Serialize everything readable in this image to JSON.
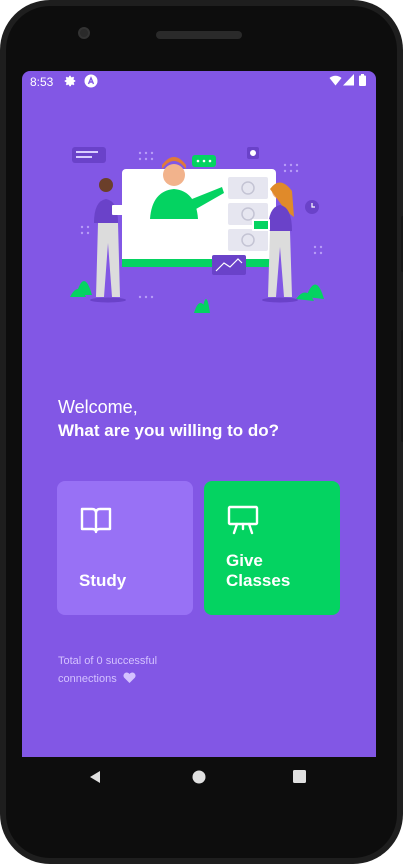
{
  "status_bar": {
    "time": "8:53",
    "icons": [
      "gear-icon",
      "app-icon",
      "wifi-icon",
      "signal-icon",
      "battery-icon"
    ]
  },
  "illustration": {
    "name": "landing-illustration"
  },
  "welcome": {
    "greeting": "Welcome,",
    "question": "What are you willing to do?"
  },
  "actions": {
    "study": {
      "label": "Study",
      "icon": "book-open-icon",
      "color": "#9871f5"
    },
    "give_classes": {
      "label_line1": "Give",
      "label_line2": "Classes",
      "icon": "presentation-icon",
      "color": "#04d361"
    }
  },
  "connections": {
    "line1": "Total of 0 successful",
    "line2": "connections",
    "icon": "heart-icon"
  },
  "nav": {
    "buttons": [
      "back-icon",
      "home-icon",
      "recents-icon"
    ]
  },
  "colors": {
    "primary": "#8257e5",
    "card_study": "#9871f5",
    "card_give": "#04d361"
  }
}
